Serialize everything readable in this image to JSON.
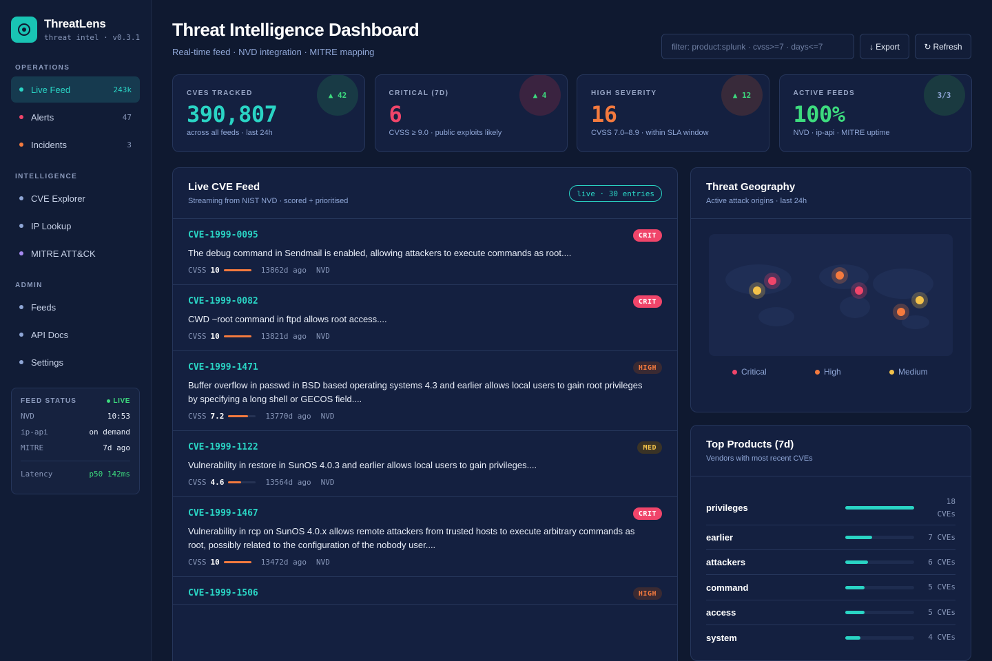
{
  "brand": {
    "name": "ThreatLens",
    "sub": "threat intel · v0.3.1"
  },
  "nav": {
    "operations_label": "OPERATIONS",
    "intelligence_label": "INTELLIGENCE",
    "admin_label": "ADMIN",
    "operations": [
      {
        "label": "Live Feed",
        "count": "243k",
        "color": "#2ad4c4"
      },
      {
        "label": "Alerts",
        "count": "47",
        "color": "#f0456a"
      },
      {
        "label": "Incidents",
        "count": "3",
        "color": "#f47a3e"
      }
    ],
    "intelligence": [
      {
        "label": "CVE Explorer",
        "color": "#8fa6d6"
      },
      {
        "label": "IP Lookup",
        "color": "#8fa6d6"
      },
      {
        "label": "MITRE ATT&CK",
        "color": "#a689f0"
      }
    ],
    "admin": [
      {
        "label": "Feeds",
        "color": "#8fa6d6"
      },
      {
        "label": "API Docs",
        "color": "#8fa6d6"
      },
      {
        "label": "Settings",
        "color": "#8fa6d6"
      }
    ]
  },
  "feed_status": {
    "title": "FEED STATUS",
    "live": "LIVE",
    "rows": [
      {
        "k": "NVD",
        "v": "10:53"
      },
      {
        "k": "ip-api",
        "v": "on demand"
      },
      {
        "k": "MITRE",
        "v": "7d ago"
      }
    ],
    "latency_label": "Latency",
    "latency_value": "p50 142ms"
  },
  "header": {
    "title": "Threat Intelligence Dashboard",
    "subtitle": "Real-time feed · NVD integration · MITRE mapping",
    "filter_placeholder": "filter: product:splunk · cvss>=7 · days<=7",
    "export_label": "Export",
    "refresh_label": "Refresh"
  },
  "stats": [
    {
      "label": "CVES TRACKED",
      "value": "390,807",
      "foot": "across all feeds · last 24h",
      "badge": "▲ 42",
      "value_color": "#2ad4c4",
      "badge_color": "#3ddb7e",
      "badge_bg": "#183a45"
    },
    {
      "label": "CRITICAL (7D)",
      "value": "6",
      "foot": "CVSS ≥ 9.0 · public exploits likely",
      "badge": "▲ 4",
      "value_color": "#f0456a",
      "badge_color": "#3ddb7e",
      "badge_bg": "#3a2340"
    },
    {
      "label": "HIGH SEVERITY",
      "value": "16",
      "foot": "CVSS 7.0–8.9 · within SLA window",
      "badge": "▲ 12",
      "value_color": "#f47a3e",
      "badge_color": "#3ddb7e",
      "badge_bg": "#382a3a"
    },
    {
      "label": "ACTIVE FEEDS",
      "value": "100%",
      "foot": "NVD · ip-api · MITRE uptime",
      "badge": "3/3",
      "value_color": "#3ddb7e",
      "badge_color": "#8fa6d6",
      "badge_bg": "#1a3a40"
    }
  ],
  "feed": {
    "title": "Live CVE Feed",
    "subtitle": "Streaming from NIST NVD · scored + prioritised",
    "pill": "live · 30 entries",
    "cvss_label": "CVSS",
    "items": [
      {
        "id": "CVE-1999-0095",
        "severity": "CRIT",
        "desc": "The debug command in Sendmail is enabled, allowing attackers to execute commands as root....",
        "score": "10",
        "score_pct": 1.0,
        "age": "13862d ago",
        "source": "NVD"
      },
      {
        "id": "CVE-1999-0082",
        "severity": "CRIT",
        "desc": "CWD ~root command in ftpd allows root access....",
        "score": "10",
        "score_pct": 1.0,
        "age": "13821d ago",
        "source": "NVD"
      },
      {
        "id": "CVE-1999-1471",
        "severity": "HIGH",
        "desc": "Buffer overflow in passwd in BSD based operating systems 4.3 and earlier allows local users to gain root privileges by specifying a long shell or GECOS field....",
        "score": "7.2",
        "score_pct": 0.72,
        "age": "13770d ago",
        "source": "NVD"
      },
      {
        "id": "CVE-1999-1122",
        "severity": "MED",
        "desc": "Vulnerability in restore in SunOS 4.0.3 and earlier allows local users to gain privileges....",
        "score": "4.6",
        "score_pct": 0.46,
        "age": "13564d ago",
        "source": "NVD"
      },
      {
        "id": "CVE-1999-1467",
        "severity": "CRIT",
        "desc": "Vulnerability in rcp on SunOS 4.0.x allows remote attackers from trusted hosts to execute arbitrary commands as root, possibly related to the configuration of the nobody user....",
        "score": "10",
        "score_pct": 1.0,
        "age": "13472d ago",
        "source": "NVD"
      },
      {
        "id": "CVE-1999-1506",
        "severity": "HIGH",
        "desc": "",
        "score": "",
        "score_pct": 0,
        "age": "",
        "source": ""
      }
    ]
  },
  "geo": {
    "title": "Threat Geography",
    "subtitle": "Active attack origins · last 24h",
    "legend": [
      {
        "label": "Critical",
        "color": "#f0456a"
      },
      {
        "label": "High",
        "color": "#f47a3e"
      },
      {
        "label": "Medium",
        "color": "#f3c24a"
      }
    ],
    "markers": [
      {
        "level": "critical",
        "color": "#f0456a"
      },
      {
        "level": "medium",
        "color": "#f3c24a"
      },
      {
        "level": "high",
        "color": "#f47a3e"
      },
      {
        "level": "critical",
        "color": "#f0456a"
      },
      {
        "level": "medium",
        "color": "#f3c24a"
      },
      {
        "level": "high",
        "color": "#f47a3e"
      }
    ]
  },
  "products": {
    "title": "Top Products (7d)",
    "subtitle": "Vendors with most recent CVEs",
    "items": [
      {
        "name": "privileges",
        "count": "18 CVEs",
        "value": 18
      },
      {
        "name": "earlier",
        "count": "7 CVEs",
        "value": 7
      },
      {
        "name": "attackers",
        "count": "6 CVEs",
        "value": 6
      },
      {
        "name": "command",
        "count": "5 CVEs",
        "value": 5
      },
      {
        "name": "access",
        "count": "5 CVEs",
        "value": 5
      },
      {
        "name": "system",
        "count": "4 CVEs",
        "value": 4
      }
    ]
  }
}
